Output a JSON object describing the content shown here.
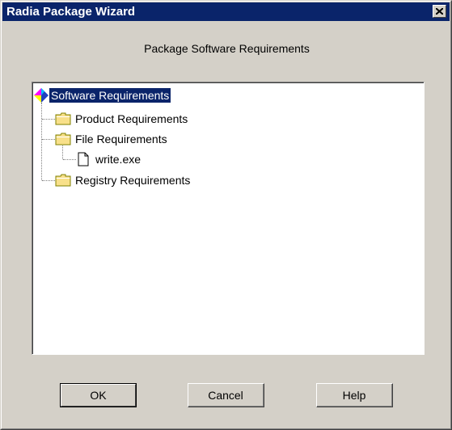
{
  "window": {
    "title": "Radia Package Wizard",
    "close_label": "X"
  },
  "page": {
    "subtitle": "Package Software Requirements"
  },
  "tree": {
    "root": {
      "label": "Software Requirements",
      "icon": "radia-package-icon",
      "selected": true
    },
    "children": [
      {
        "label": "Product Requirements",
        "icon": "folder-icon"
      },
      {
        "label": "File Requirements",
        "icon": "folder-icon",
        "children": [
          {
            "label": "write.exe",
            "icon": "file-icon"
          }
        ]
      },
      {
        "label": "Registry Requirements",
        "icon": "folder-icon"
      }
    ]
  },
  "buttons": {
    "ok": "OK",
    "cancel": "Cancel",
    "help": "Help"
  },
  "colors": {
    "titlebar": "#0a246a",
    "face": "#d4d0c8",
    "selection": "#0a246a",
    "folder": "#f8e08a"
  }
}
